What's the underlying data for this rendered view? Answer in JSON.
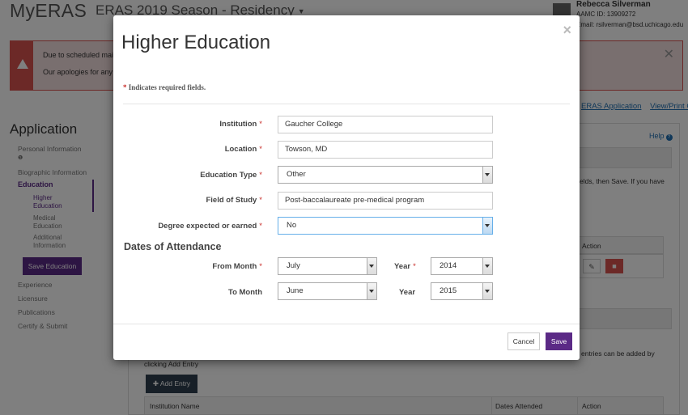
{
  "header": {
    "logo": "MyERAS",
    "season": "ERAS 2019 Season - Residency",
    "user_name": "Rebecca Silverman",
    "aamc_id": "AAMC ID: 13909272",
    "email": "Email: rsilverman@bsd.uchicago.edu"
  },
  "alert": {
    "line1": "Due to scheduled maint",
    "line2": "Our apologies for any in"
  },
  "top_links": [
    "ERAS Application",
    "View/Print CV"
  ],
  "sidebar": {
    "title": "Application",
    "items": [
      "Personal Information",
      "Biographic Information",
      "Education",
      "Experience",
      "Licensure",
      "Publications",
      "Certify & Submit"
    ],
    "sub_items": [
      [
        "Higher",
        "Education"
      ],
      [
        "Medical",
        "Education"
      ],
      [
        "Additional",
        "Information"
      ]
    ],
    "save_button": "Save Education"
  },
  "main": {
    "help": "Help",
    "instr1": "elds, then Save. If you have",
    "instr2": "",
    "action_header": "Action",
    "entries_line1": "entries can be added by",
    "entries_line2": "clicking Add Entry",
    "add_entry": "Add Entry",
    "table_headers": [
      "Institution Name",
      "Dates Attended",
      "Action"
    ]
  },
  "modal": {
    "title": "Higher Education",
    "close": "×",
    "required_note": "Indicates required fields.",
    "fields": {
      "institution": {
        "label": "Institution",
        "value": "Gaucher College"
      },
      "location": {
        "label": "Location",
        "value": "Towson, MD"
      },
      "education_type": {
        "label": "Education Type",
        "value": "Other"
      },
      "field_of_study": {
        "label": "Field of Study",
        "value": "Post-baccalaureate pre-medical program"
      },
      "degree": {
        "label": "Degree expected or earned",
        "value": "No"
      }
    },
    "dates_title": "Dates of Attendance",
    "from_month": {
      "label": "From Month",
      "value": "July"
    },
    "from_year": {
      "label": "Year",
      "value": "2014"
    },
    "to_month": {
      "label": "To Month",
      "value": "June"
    },
    "to_year": {
      "label": "Year",
      "value": "2015"
    },
    "cancel": "Cancel",
    "save": "Save"
  },
  "colors": {
    "accent": "#5b2a86",
    "danger": "#d9534f",
    "link": "#1f6fb2"
  }
}
